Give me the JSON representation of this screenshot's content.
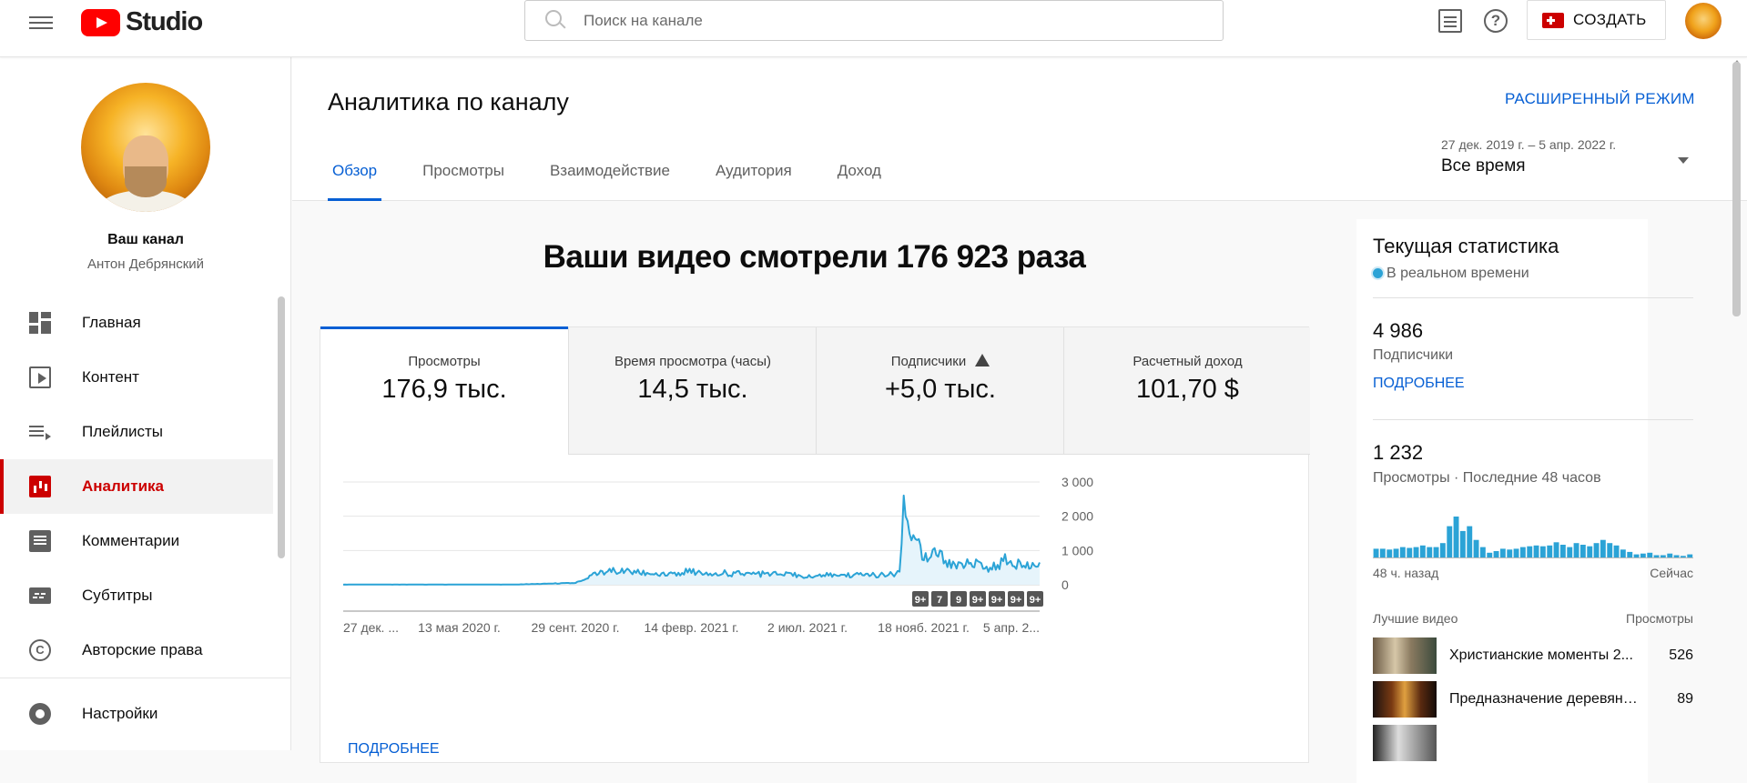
{
  "app": {
    "logo_text": "Studio",
    "search_placeholder": "Поиск на канале",
    "create_label": "СОЗДАТЬ"
  },
  "sidebar": {
    "channel_name": "Ваш канал",
    "channel_owner": "Антон Дебрянский",
    "items": [
      {
        "label": "Главная",
        "icon": "dashboard-icon"
      },
      {
        "label": "Контент",
        "icon": "content-icon"
      },
      {
        "label": "Плейлисты",
        "icon": "playlists-icon"
      },
      {
        "label": "Аналитика",
        "icon": "analytics-icon",
        "active": true
      },
      {
        "label": "Комментарии",
        "icon": "comments-icon"
      },
      {
        "label": "Субтитры",
        "icon": "subtitles-icon"
      },
      {
        "label": "Авторские права",
        "icon": "copyright-icon"
      }
    ],
    "settings_label": "Настройки"
  },
  "header": {
    "title": "Аналитика по каналу",
    "advanced_mode": "РАСШИРЕННЫЙ РЕЖИМ",
    "tabs": [
      {
        "label": "Обзор",
        "active": true
      },
      {
        "label": "Просмотры"
      },
      {
        "label": "Взаимодействие"
      },
      {
        "label": "Аудитория"
      },
      {
        "label": "Доход"
      }
    ],
    "date_range": "27 дек. 2019 г. – 5 апр. 2022 г.",
    "date_label": "Все время"
  },
  "summary": {
    "headline": "Ваши видео смотрели 176 923 раза",
    "metrics": [
      {
        "label": "Просмотры",
        "value": "176,9 тыс.",
        "active": true
      },
      {
        "label": "Время просмотра (часы)",
        "value": "14,5 тыс."
      },
      {
        "label": "Подписчики",
        "value": "+5,0 тыс.",
        "warning": true
      },
      {
        "label": "Расчетный доход",
        "value": "101,70 $"
      }
    ],
    "more_link": "ПОДРОБНЕЕ"
  },
  "chart_data": {
    "type": "area",
    "title": "",
    "xlabel": "",
    "ylabel": "",
    "ylim": [
      0,
      3000
    ],
    "y_ticks": [
      "3 000",
      "2 000",
      "1 000",
      "0"
    ],
    "x_ticks": [
      "27 дек. ...",
      "13 мая 2020 г.",
      "29 сент. 2020 г.",
      "14 февр. 2021 г.",
      "2 июл. 2021 г.",
      "18 нояб. 2021 г.",
      "5 апр. 2..."
    ],
    "markers": [
      "9+",
      "7",
      "9",
      "9+",
      "9+",
      "9+",
      "9+"
    ],
    "color": "#2ba3d6",
    "grid": true,
    "series": [
      {
        "x": [
          "2019-12-27",
          "2020-03-01",
          "2020-05-13",
          "2020-07-15",
          "2020-09-29",
          "2020-10-20",
          "2020-11-15",
          "2020-12-10",
          "2021-01-05",
          "2021-02-14",
          "2021-03-15",
          "2021-04-20",
          "2021-05-25",
          "2021-07-02",
          "2021-08-05",
          "2021-09-10",
          "2021-10-05",
          "2021-10-20",
          "2021-10-25",
          "2021-11-01",
          "2021-11-10",
          "2021-11-18",
          "2021-12-05",
          "2021-12-25",
          "2022-01-15",
          "2022-02-05",
          "2022-02-25",
          "2022-03-15",
          "2022-04-05"
        ],
        "values": [
          5,
          5,
          5,
          5,
          50,
          300,
          400,
          350,
          330,
          380,
          340,
          320,
          300,
          260,
          280,
          290,
          280,
          330,
          2500,
          1500,
          1300,
          850,
          900,
          500,
          650,
          450,
          750,
          550,
          650
        ]
      }
    ]
  },
  "realtime": {
    "title": "Текущая статистика",
    "live_label": "В реальном времени",
    "subscribers_value": "4 986",
    "subscribers_label": "Подписчики",
    "more_link": "ПОДРОБНЕЕ",
    "views_value": "1 232",
    "views_label": "Просмотры · Последние 48 часов",
    "axis_left": "48 ч. назад",
    "axis_right": "Сейчас",
    "hourly_views": [
      12,
      12,
      11,
      12,
      14,
      13,
      14,
      16,
      14,
      14,
      19,
      40,
      52,
      34,
      40,
      23,
      14,
      7,
      9,
      12,
      11,
      12,
      14,
      15,
      16,
      15,
      16,
      20,
      17,
      14,
      19,
      17,
      15,
      19,
      23,
      19,
      16,
      11,
      8,
      5,
      6,
      7,
      4,
      4,
      6,
      4,
      3,
      5
    ],
    "top_videos_header": "Лучшие видео",
    "top_videos_views_header": "Просмотры",
    "top_videos": [
      {
        "title": "Христианские моменты 2...",
        "views": "526"
      },
      {
        "title": "Предназначение деревянн...",
        "views": "89"
      },
      {
        "title": "",
        "views": ""
      }
    ]
  }
}
